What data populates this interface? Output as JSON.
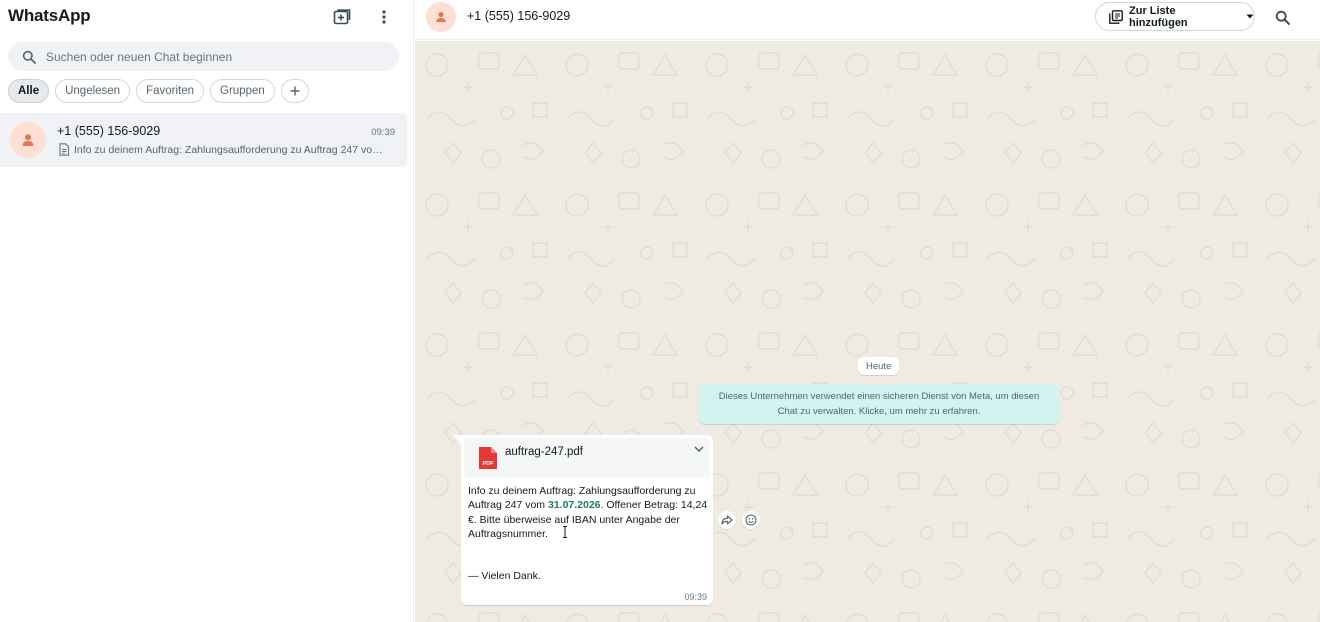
{
  "app": {
    "title": "WhatsApp"
  },
  "sidebar": {
    "search_placeholder": "Suchen oder neuen Chat beginnen",
    "filters": [
      "Alle",
      "Ungelesen",
      "Favoriten",
      "Gruppen"
    ],
    "active_filter": "Alle",
    "chats": [
      {
        "name": "+1 (555) 156-9029",
        "time": "09:39",
        "preview": "Info zu deinem Auftrag: Zahlungsaufforderung zu Auftrag 247 vo…"
      }
    ]
  },
  "chat": {
    "contact": "+1 (555) 156-9029",
    "add_to_list_label": "Zur Liste hinzufügen",
    "date_divider": "Heute",
    "system_message": "Dieses Unternehmen verwendet einen sicheren Dienst von Meta, um diesen Chat zu verwalten. Klicke, um mehr zu erfahren.",
    "message": {
      "file_name": "auftrag-247.pdf",
      "file_type": "PDF",
      "text_before": "Info zu deinem Auftrag: Zahlungsaufforderung zu Auftrag 247 vom ",
      "date": "31.07.2026",
      "text_after": ". Offener Betrag: 14,24 €. Bitte überweise auf IBAN unter Angabe der Auftragsnummer.",
      "sign_off": "— Vielen Dank.",
      "time": "09:39"
    }
  },
  "colors": {
    "chat_background": "#efeae2",
    "system_bubble": "#d1f4f0",
    "date_highlight": "#1d7a5c",
    "avatar_bg": "#fde0d3",
    "avatar_fg": "#e07a52",
    "pdf_red": "#e53935"
  },
  "icons": {
    "new_chat": "new-chat-icon",
    "menu": "more-vertical-icon",
    "search": "search-icon",
    "avatar": "person-icon",
    "document": "document-icon",
    "list": "list-icon",
    "caret": "caret-down-icon",
    "pdf": "pdf-icon",
    "chevron": "chevron-down-icon",
    "forward": "forward-icon",
    "emoji": "emoji-icon"
  }
}
